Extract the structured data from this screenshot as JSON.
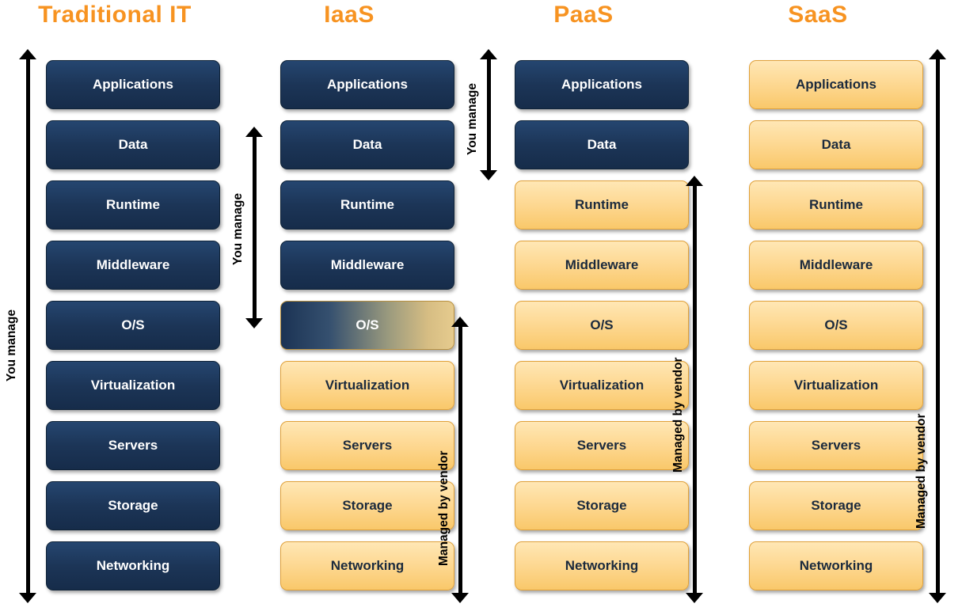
{
  "columns": [
    {
      "title": "Traditional IT",
      "layers": [
        {
          "label": "Applications",
          "style": "dark"
        },
        {
          "label": "Data",
          "style": "dark"
        },
        {
          "label": "Runtime",
          "style": "dark"
        },
        {
          "label": "Middleware",
          "style": "dark"
        },
        {
          "label": "O/S",
          "style": "dark"
        },
        {
          "label": "Virtualization",
          "style": "dark"
        },
        {
          "label": "Servers",
          "style": "dark"
        },
        {
          "label": "Storage",
          "style": "dark"
        },
        {
          "label": "Networking",
          "style": "dark"
        }
      ],
      "arrows": [
        {
          "label": "You manage",
          "side": "left",
          "from": 0,
          "to": 8
        }
      ]
    },
    {
      "title": "IaaS",
      "layers": [
        {
          "label": "Applications",
          "style": "dark"
        },
        {
          "label": "Data",
          "style": "dark"
        },
        {
          "label": "Runtime",
          "style": "dark"
        },
        {
          "label": "Middleware",
          "style": "dark"
        },
        {
          "label": "O/S",
          "style": "gradient-mix"
        },
        {
          "label": "Virtualization",
          "style": "light"
        },
        {
          "label": "Servers",
          "style": "light"
        },
        {
          "label": "Storage",
          "style": "light"
        },
        {
          "label": "Networking",
          "style": "light"
        }
      ],
      "arrows": [
        {
          "label": "You manage",
          "side": "left",
          "from": 0,
          "to": 4
        },
        {
          "label": "Managed by vendor",
          "side": "right",
          "from": 4,
          "to": 8
        }
      ]
    },
    {
      "title": "PaaS",
      "layers": [
        {
          "label": "Applications",
          "style": "dark"
        },
        {
          "label": "Data",
          "style": "dark"
        },
        {
          "label": "Runtime",
          "style": "light"
        },
        {
          "label": "Middleware",
          "style": "light"
        },
        {
          "label": "O/S",
          "style": "light"
        },
        {
          "label": "Virtualization",
          "style": "light"
        },
        {
          "label": "Servers",
          "style": "light"
        },
        {
          "label": "Storage",
          "style": "light"
        },
        {
          "label": "Networking",
          "style": "light"
        }
      ],
      "arrows": [
        {
          "label": "You manage",
          "side": "left",
          "from": 0,
          "to": 1
        },
        {
          "label": "Managed by vendor",
          "side": "right",
          "from": 2,
          "to": 8
        }
      ]
    },
    {
      "title": "SaaS",
      "layers": [
        {
          "label": "Applications",
          "style": "light"
        },
        {
          "label": "Data",
          "style": "light"
        },
        {
          "label": "Runtime",
          "style": "light"
        },
        {
          "label": "Middleware",
          "style": "light"
        },
        {
          "label": "O/S",
          "style": "light"
        },
        {
          "label": "Virtualization",
          "style": "light"
        },
        {
          "label": "Servers",
          "style": "light"
        },
        {
          "label": "Storage",
          "style": "light"
        },
        {
          "label": "Networking",
          "style": "light"
        }
      ],
      "arrows": [
        {
          "label": "Managed by vendor",
          "side": "right",
          "from": 0,
          "to": 8
        }
      ]
    }
  ],
  "colors": {
    "title": "#F79321",
    "dark_layer": "#1c3557",
    "light_layer": "#fcd68a",
    "arrow": "#000000"
  }
}
